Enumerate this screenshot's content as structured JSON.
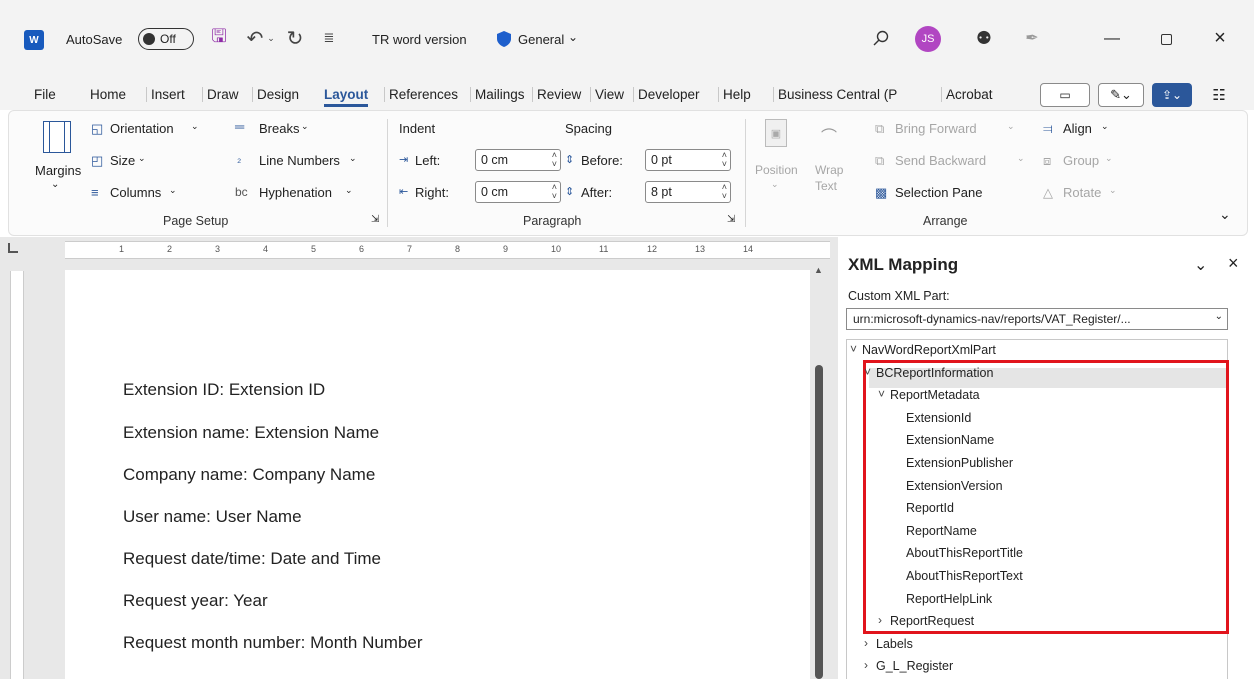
{
  "titlebar": {
    "autosave_label": "AutoSave",
    "toggle_label": "Off",
    "doc_title": "TR word version",
    "sensitivity": "General",
    "avatar_initials": "JS"
  },
  "tabs": [
    "File",
    "Home",
    "Insert",
    "Draw",
    "Design",
    "Layout",
    "References",
    "Mailings",
    "Review",
    "View",
    "Developer",
    "Help",
    "Business Central (P",
    "Acrobat"
  ],
  "active_tab": "Layout",
  "ribbon": {
    "page_setup": {
      "margins": "Margins",
      "orientation": "Orientation",
      "size": "Size",
      "columns": "Columns",
      "breaks": "Breaks",
      "line_numbers": "Line Numbers",
      "hyphenation": "Hyphenation",
      "group": "Page Setup"
    },
    "paragraph": {
      "indent": "Indent",
      "spacing": "Spacing",
      "left": "Left:",
      "right": "Right:",
      "before": "Before:",
      "after": "After:",
      "left_val": "0 cm",
      "right_val": "0 cm",
      "before_val": "0 pt",
      "after_val": "8 pt",
      "group": "Paragraph"
    },
    "arrange": {
      "position": "Position",
      "wrap": "Wrap",
      "wrap2": "Text",
      "bring_forward": "Bring Forward",
      "send_backward": "Send Backward",
      "selection_pane": "Selection Pane",
      "align": "Align",
      "group_btn": "Group",
      "rotate": "Rotate",
      "group": "Arrange"
    }
  },
  "ruler_numbers": [
    "1",
    "2",
    "3",
    "4",
    "5",
    "6",
    "7",
    "8",
    "9",
    "10",
    "11",
    "12",
    "13",
    "14"
  ],
  "document": {
    "lines": [
      "Extension ID: Extension ID",
      "Extension name: Extension Name",
      "Company name: Company Name",
      "User name: User Name",
      "Request date/time: Date and Time",
      "Request year: Year",
      "Request month number: Month Number"
    ]
  },
  "xml_pane": {
    "title": "XML Mapping",
    "custom_part_label": "Custom XML Part:",
    "custom_part_value": "urn:microsoft-dynamics-nav/reports/VAT_Register/...",
    "root": "NavWordReportXmlPart",
    "bc_info": "BCReportInformation",
    "report_metadata": "ReportMetadata",
    "metadata_items": [
      "ExtensionId",
      "ExtensionName",
      "ExtensionPublisher",
      "ExtensionVersion",
      "ReportId",
      "ReportName",
      "AboutThisReportTitle",
      "AboutThisReportText",
      "ReportHelpLink"
    ],
    "report_request": "ReportRequest",
    "labels": "Labels",
    "gl_register": "G_L_Register"
  },
  "colors": {
    "accent": "#2b579a",
    "highlight": "#e1141c",
    "avatar": "#b146c2"
  }
}
